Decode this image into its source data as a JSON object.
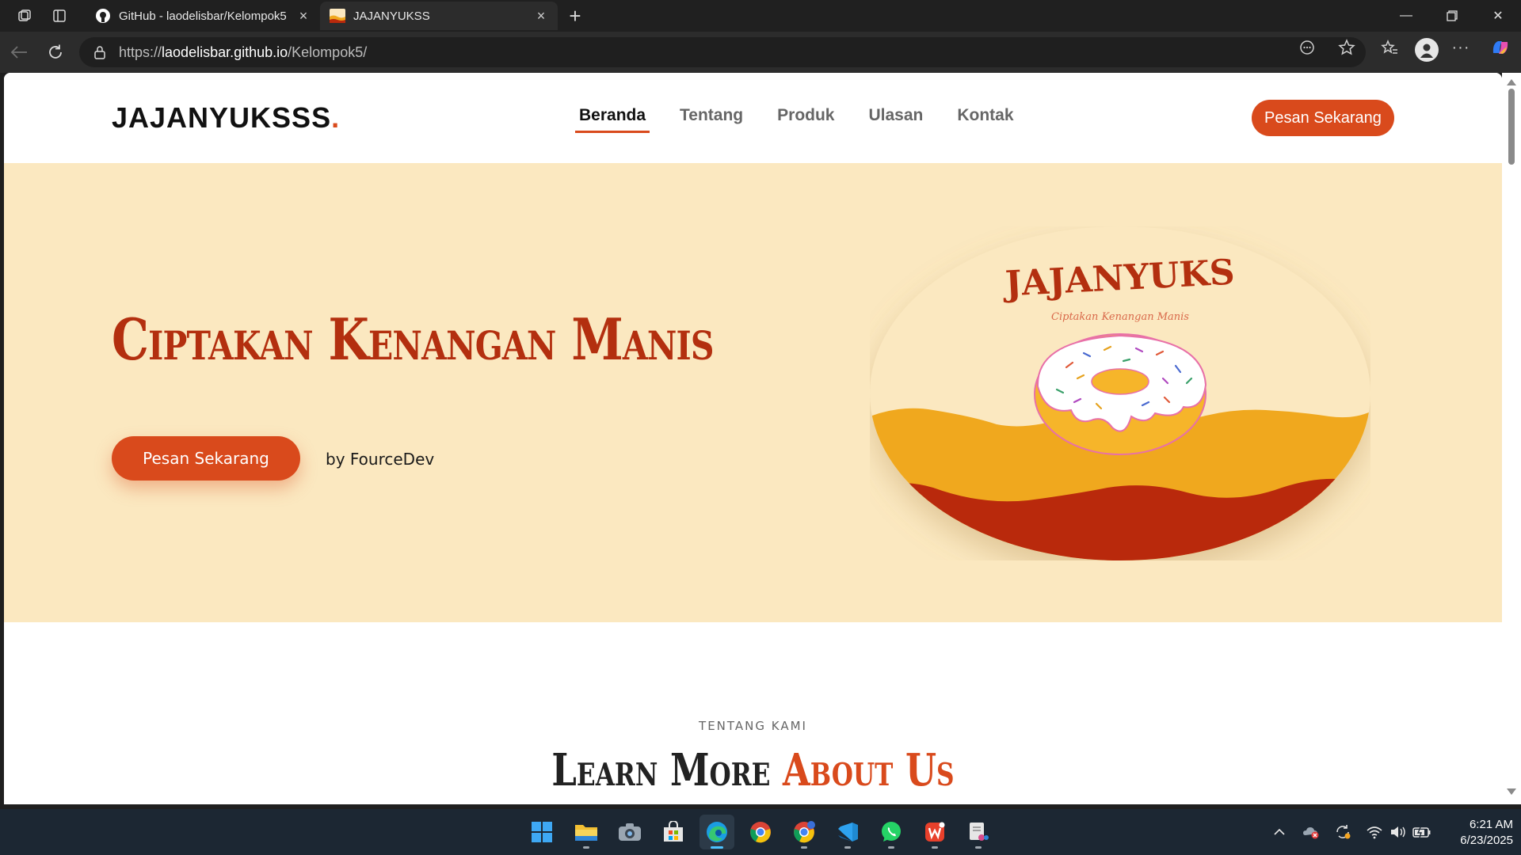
{
  "browser": {
    "tabs": [
      {
        "title": "GitHub - laodelisbar/Kelompok5",
        "active": false
      },
      {
        "title": "JAJANYUKSS",
        "active": true
      }
    ],
    "url_prefix": "https://",
    "url_host": "laodelisbar.github.io",
    "url_path": "/Kelompok5/"
  },
  "site": {
    "logo_text": "JAJANYUKSSS",
    "logo_dot": ".",
    "nav": [
      {
        "label": "Beranda",
        "active": true
      },
      {
        "label": "Tentang",
        "active": false
      },
      {
        "label": "Produk",
        "active": false
      },
      {
        "label": "Ulasan",
        "active": false
      },
      {
        "label": "Kontak",
        "active": false
      }
    ],
    "header_cta": "Pesan Sekarang",
    "hero": {
      "title": "Ciptakan Kenangan Manis",
      "cta": "Pesan Sekarang",
      "byline": "by FourceDev",
      "image_brand": "JAJANYUKS",
      "image_tagline": "Ciptakan Kenangan Manis"
    },
    "about": {
      "kicker": "TENTANG KAMI",
      "title_main": "Learn More",
      "title_accent": "About Us"
    }
  },
  "taskbar": {
    "apps": [
      "start",
      "file-explorer",
      "camera",
      "microsoft-store",
      "edge",
      "chrome",
      "chrome-profile",
      "vscode",
      "whatsapp",
      "wps-office",
      "snipping-tool"
    ],
    "active_app": "edge",
    "time": "6:21 AM",
    "date": "6/23/2025"
  },
  "colors": {
    "accent": "#d94a1c",
    "hero_bg": "#fbe8c0",
    "hero_title": "#b32f0f",
    "wave_orange": "#f0a81e",
    "wave_red": "#b9290c"
  }
}
